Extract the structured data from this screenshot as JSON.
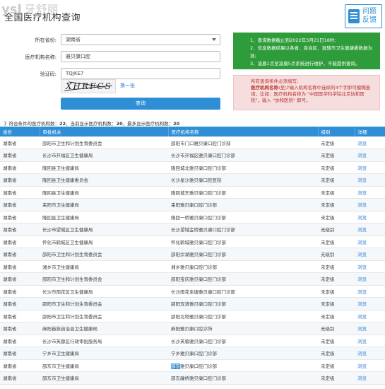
{
  "header": {
    "title": "全国医疗机构查询",
    "watermark": "ysl",
    "watermark_cn": "牙舒丽",
    "feedback_label_line1": "问题",
    "feedback_label_line2": "反馈"
  },
  "form": {
    "region_label": "所在省份:",
    "region_value": "湖南省",
    "name_label": "医疗机构名称:",
    "name_value": "雅贝康口腔",
    "captcha_label": "验证码:",
    "captcha_value": "TQJKE7",
    "captcha_image_text": "XHRFCS",
    "refresh_label": "换一张",
    "submit_label": "查询"
  },
  "notice": {
    "green_line1": "1、查询数据截止到2022年3月21日18时;",
    "green_line2": "2、信息数据结果以各省、自治区、直辖市卫生健康委数据为准;",
    "green_line3": "3、凌晨1点至凌晨5点系统进行维护，不能提供查询。",
    "pink_line1": "所有查询条件必须填写;",
    "pink_line2_bold": "医疗机构名称:",
    "pink_line2": "至少输入机构名称中连续的4个字即可模糊查询，比如：医疗机构名称为 \"中国医学科学院北京协和医院\"，输入 \"协和医院\" 即可。"
  },
  "summary": {
    "prefix": "》符合条件的医疗机构数：",
    "total": "22",
    "mid": "，当前显示医疗机构数：",
    "shown": "20",
    "suffix": "，最多显示医疗机构数：",
    "max": "20"
  },
  "table": {
    "headers": [
      "省份",
      "审批机关",
      "医疗机构名称",
      "级别",
      "详细"
    ],
    "rows": [
      [
        "湖南省",
        "邵阳市卫生和计划生育委员会",
        "邵阳市门口雅贝康口腔门诊部",
        "未定级",
        "浏览"
      ],
      [
        "湖南省",
        "长沙市开福区卫生健康局",
        "长沙市开福区雅贝康口腔门诊部",
        "未定级",
        "浏览"
      ],
      [
        "湖南省",
        "隆回县卫生健康局",
        "隆回城北雅贝康口腔门诊部",
        "未定级",
        "浏览"
      ],
      [
        "湖南省",
        "隆回县卫生健康委员会",
        "长沙星沙雅贝康口腔医院",
        "未定级",
        "浏览"
      ],
      [
        "湖南省",
        "隆回县卫生健康局",
        "隆回城东雅贝康口腔门诊部",
        "未定级",
        "浏览"
      ],
      [
        "湖南省",
        "耒阳市卫生健康局",
        "耒阳雅贝康口腔门诊部",
        "未定级",
        "浏览"
      ],
      [
        "湖南省",
        "隆回县卫生健康局",
        "隆回一桥雅贝康口腔门诊部",
        "未定级",
        "浏览"
      ],
      [
        "湖南省",
        "长沙市望城区卫生健康局",
        "长沙望城金桥雅贝康口腔门诊部",
        "无级别",
        "浏览"
      ],
      [
        "湖南省",
        "怀化市鹤城区卫生健康局",
        "怀化鹤城雅贝康口腔门诊部",
        "未定级",
        "浏览"
      ],
      [
        "湖南省",
        "邵阳市卫生和计划生育委员会",
        "邵阳佘湖雅贝康口腔门诊部",
        "无级别",
        "浏览"
      ],
      [
        "湖南省",
        "湘乡市卫生健康局",
        "湘乡雅贝康口腔门诊部",
        "未定级",
        "浏览"
      ],
      [
        "湖南省",
        "邵阳市卫生和计划生育委员会",
        "邵阳宝庆雅贝康口腔门诊部",
        "未定级",
        "浏览"
      ],
      [
        "湖南省",
        "长沙市雨花区卫生健康局",
        "长沙雨花圭塘雅贝康口腔门诊部",
        "未定级",
        "浏览"
      ],
      [
        "湖南省",
        "邵阳市卫生和计划生育委员会",
        "邵阳双清雅贝康口腔门诊部",
        "未定级",
        "浏览"
      ],
      [
        "湖南省",
        "邵阳市卫生和计划生育委员会",
        "邵阳北塔雅贝康口腔门诊部",
        "未定级",
        "浏览"
      ],
      [
        "湖南省",
        "麻阳苗族自治县卫生健康局",
        "麻阳雅贝康口腔诊所",
        "无级别",
        "浏览"
      ],
      [
        "湖南省",
        "长沙市芙蓉区行政审批服务局",
        "长沙芙蓉雅贝康口腔门诊部",
        "未定级",
        "浏览"
      ],
      [
        "湖南省",
        "宁乡市卫生健康局",
        "宁乡雅贝康口腔门诊部",
        "未定级",
        "浏览"
      ],
      [
        "湖南省",
        "邵东市卫生健康局",
        "邵东雅贝康口腔门诊部",
        "未定级",
        "浏览"
      ],
      [
        "湖南省",
        "邵东市卫生健康局",
        "邵东廉桥雅贝康口腔门诊部",
        "未定级",
        "浏览"
      ]
    ],
    "highlight": "邵东"
  },
  "colors": {
    "accent": "#2f8fd6",
    "green": "#2e9c3a",
    "pink": "#f7dede"
  }
}
